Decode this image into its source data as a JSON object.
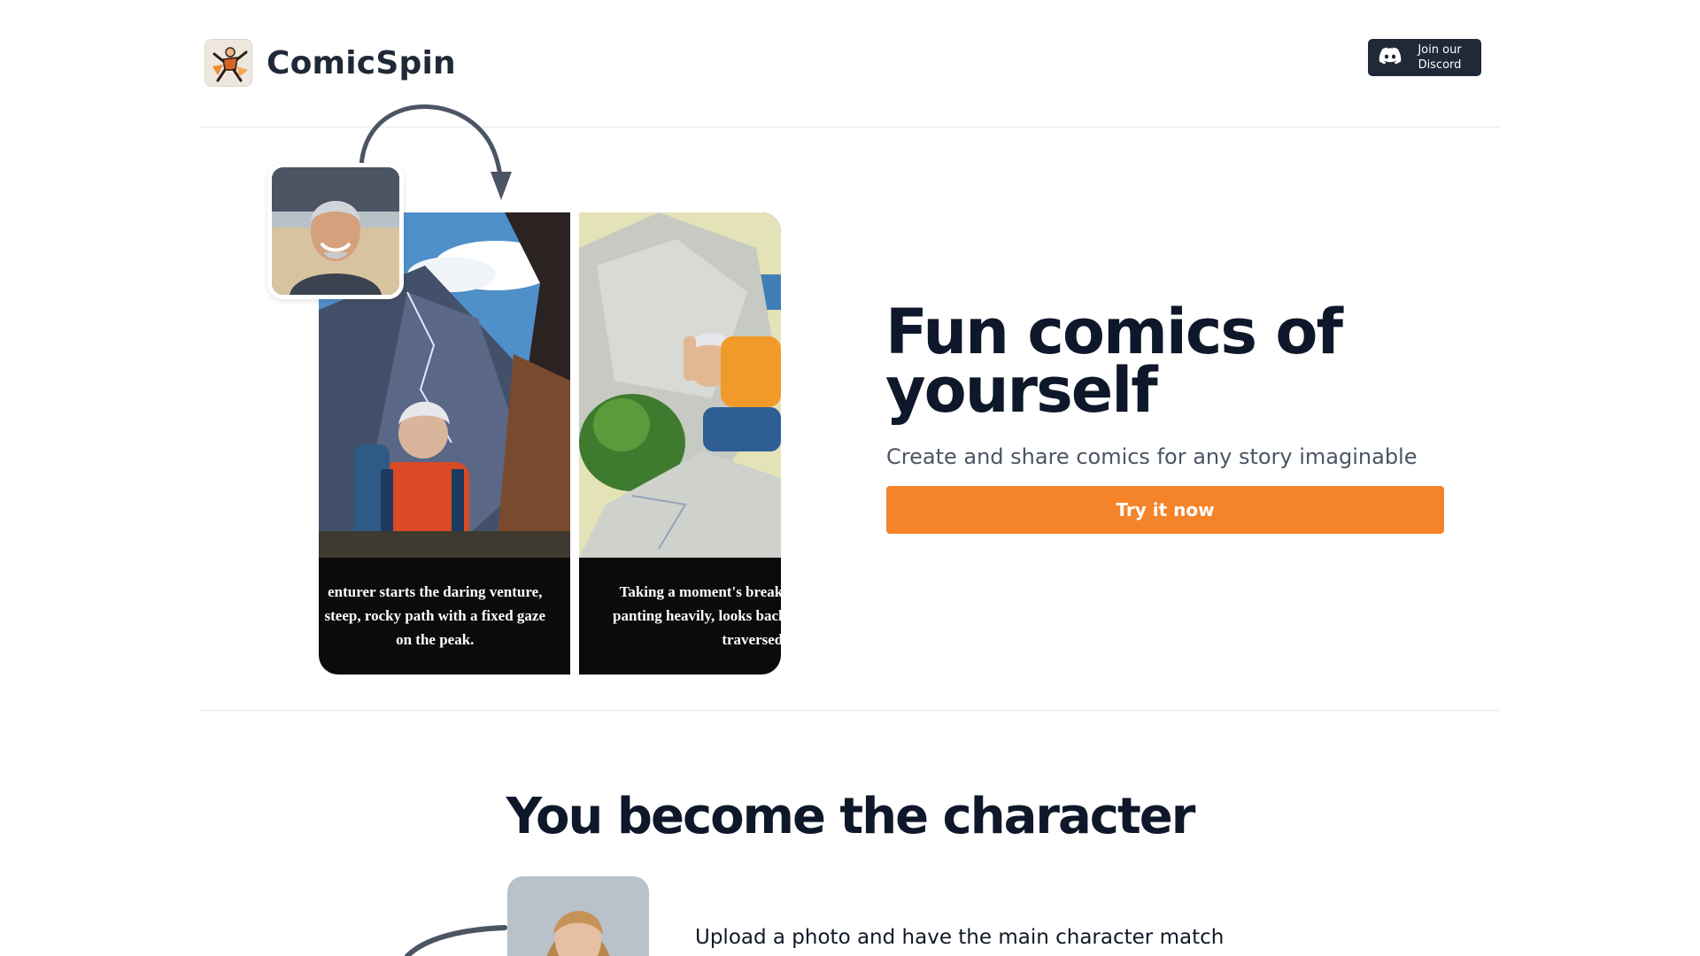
{
  "header": {
    "brand_name": "ComicSpin",
    "logo_icon": "comic-hero-logo",
    "discord_label_line1": "Join our",
    "discord_label_line2": "Discord"
  },
  "hero": {
    "title_line1": "Fun comics of",
    "title_line2": "yourself",
    "subtitle": "Create and share comics for any story imaginable",
    "cta_label": "Try it now",
    "panel_1_caption": [
      "enturer starts the daring venture,",
      "steep, rocky path with a fixed gaze",
      "on the peak."
    ],
    "panel_2_caption": [
      "Taking a moment's break,",
      "panting heavily, looks back",
      "traversed."
    ]
  },
  "section_character": {
    "title": "You become the character",
    "copy": "Upload a photo and have the main character match"
  },
  "colors": {
    "accent": "#f5832a",
    "dark": "#1f2937",
    "text": "#0f172a",
    "muted": "#4b5563",
    "divider": "#e5e7eb"
  }
}
